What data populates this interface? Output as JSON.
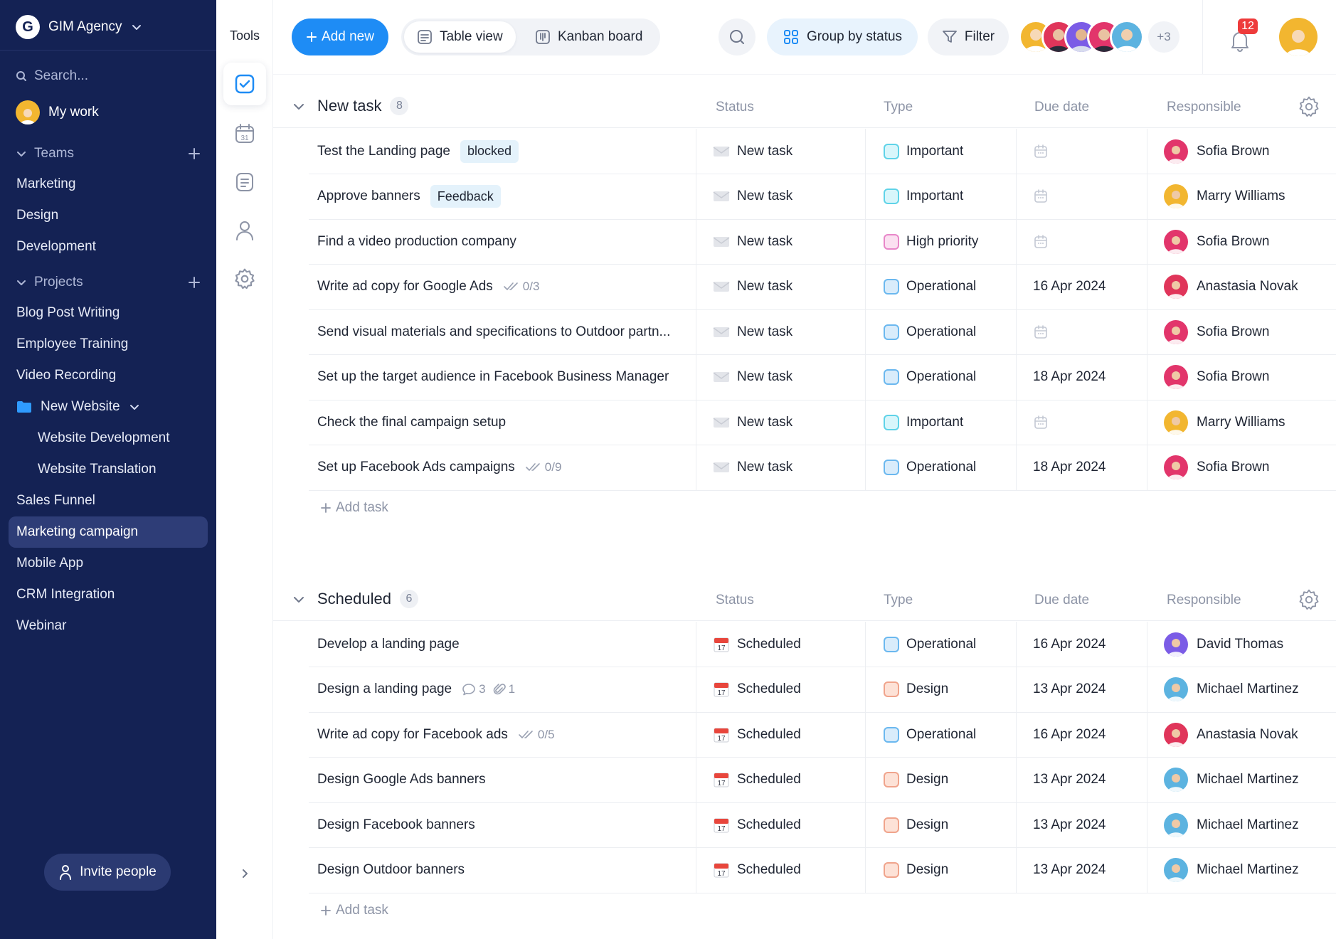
{
  "workspace": {
    "initial": "G",
    "name": "GIM Agency"
  },
  "sidebar": {
    "search_placeholder": "Search...",
    "my_work": "My work",
    "teams_label": "Teams",
    "teams": [
      "Marketing",
      "Design",
      "Development"
    ],
    "projects_label": "Projects",
    "projects": [
      "Blog Post Writing",
      "Employee Training",
      "Video Recording"
    ],
    "folder": {
      "label": "New Website",
      "children": [
        "Website Development",
        "Website Translation"
      ]
    },
    "projects_after": [
      "Sales Funnel",
      "Marketing campaign",
      "Mobile App",
      "CRM Integration",
      "Webinar"
    ],
    "active_project": "Marketing campaign",
    "invite_label": "Invite people"
  },
  "tools": {
    "title": "Tools",
    "icons": [
      "tasks-icon",
      "calendar-icon",
      "notes-icon",
      "user-icon",
      "settings-icon"
    ],
    "calendar_day": "31"
  },
  "toolbar": {
    "add_new": "Add new",
    "table_view": "Table view",
    "kanban_board": "Kanban board",
    "group_by": "Group by status",
    "filter": "Filter",
    "more_members": "+3",
    "notifications": "12"
  },
  "columns": {
    "status": "Status",
    "type": "Type",
    "due": "Due date",
    "responsible": "Responsible"
  },
  "colors": {
    "accent": "#1e8cf5",
    "sidebar": "#142254",
    "tag_bg": "#e4f2fb"
  },
  "types": {
    "Important": {
      "border": "#5fd3e8",
      "fill": "#d8f6fb"
    },
    "High priority": {
      "border": "#e887c9",
      "fill": "#fbe0f1"
    },
    "Operational": {
      "border": "#6bb8ef",
      "fill": "#d9ecfb"
    },
    "Design": {
      "border": "#f0a48c",
      "fill": "#fde2d7"
    }
  },
  "people": {
    "Sofia Brown": "#e2356b",
    "Marry Williams": "#f2b630",
    "Anastasia Novak": "#e0355a",
    "David Thomas": "#7b5ce6",
    "Michael Martinez": "#5cb3e0"
  },
  "groups": [
    {
      "title": "New task",
      "count": "8",
      "tasks": [
        {
          "name": "Test the Landing page",
          "tag": "blocked",
          "status": "New task",
          "type": "Important",
          "due": "",
          "responsible": "Sofia Brown"
        },
        {
          "name": "Approve banners",
          "tag": "Feedback",
          "status": "New task",
          "type": "Important",
          "due": "",
          "responsible": "Marry Williams"
        },
        {
          "name": "Find a video production company",
          "status": "New task",
          "type": "High priority",
          "due": "",
          "responsible": "Sofia Brown"
        },
        {
          "name": "Write ad copy for Google Ads",
          "checklist": "0/3",
          "status": "New task",
          "type": "Operational",
          "due": "16 Apr 2024",
          "responsible": "Anastasia Novak"
        },
        {
          "name": "Send visual materials and specifications to Outdoor partn...",
          "status": "New task",
          "type": "Operational",
          "due": "",
          "responsible": "Sofia Brown"
        },
        {
          "name": "Set up the target audience in Facebook Business Manager",
          "status": "New task",
          "type": "Operational",
          "due": "18 Apr 2024",
          "responsible": "Sofia Brown"
        },
        {
          "name": "Check the final campaign setup",
          "status": "New task",
          "type": "Important",
          "due": "",
          "responsible": "Marry Williams"
        },
        {
          "name": "Set up Facebook Ads campaigns",
          "checklist": "0/9",
          "status": "New task",
          "type": "Operational",
          "due": "18 Apr 2024",
          "responsible": "Sofia Brown"
        }
      ],
      "add_task": "Add task"
    },
    {
      "title": "Scheduled",
      "count": "6",
      "tasks": [
        {
          "name": "Develop a landing page",
          "status": "Scheduled",
          "type": "Operational",
          "due": "16 Apr 2024",
          "responsible": "David Thomas"
        },
        {
          "name": "Design a landing page",
          "comments": "3",
          "attachments": "1",
          "status": "Scheduled",
          "type": "Design",
          "due": "13 Apr 2024",
          "responsible": "Michael Martinez"
        },
        {
          "name": "Write ad copy for Facebook ads",
          "checklist": "0/5",
          "status": "Scheduled",
          "type": "Operational",
          "due": "16 Apr 2024",
          "responsible": "Anastasia Novak"
        },
        {
          "name": "Design Google Ads banners",
          "status": "Scheduled",
          "type": "Design",
          "due": "13 Apr 2024",
          "responsible": "Michael Martinez"
        },
        {
          "name": "Design Facebook banners",
          "status": "Scheduled",
          "type": "Design",
          "due": "13 Apr 2024",
          "responsible": "Michael Martinez"
        },
        {
          "name": "Design Outdoor banners",
          "status": "Scheduled",
          "type": "Design",
          "due": "13 Apr 2024",
          "responsible": "Michael Martinez"
        }
      ],
      "add_task": "Add task"
    }
  ]
}
